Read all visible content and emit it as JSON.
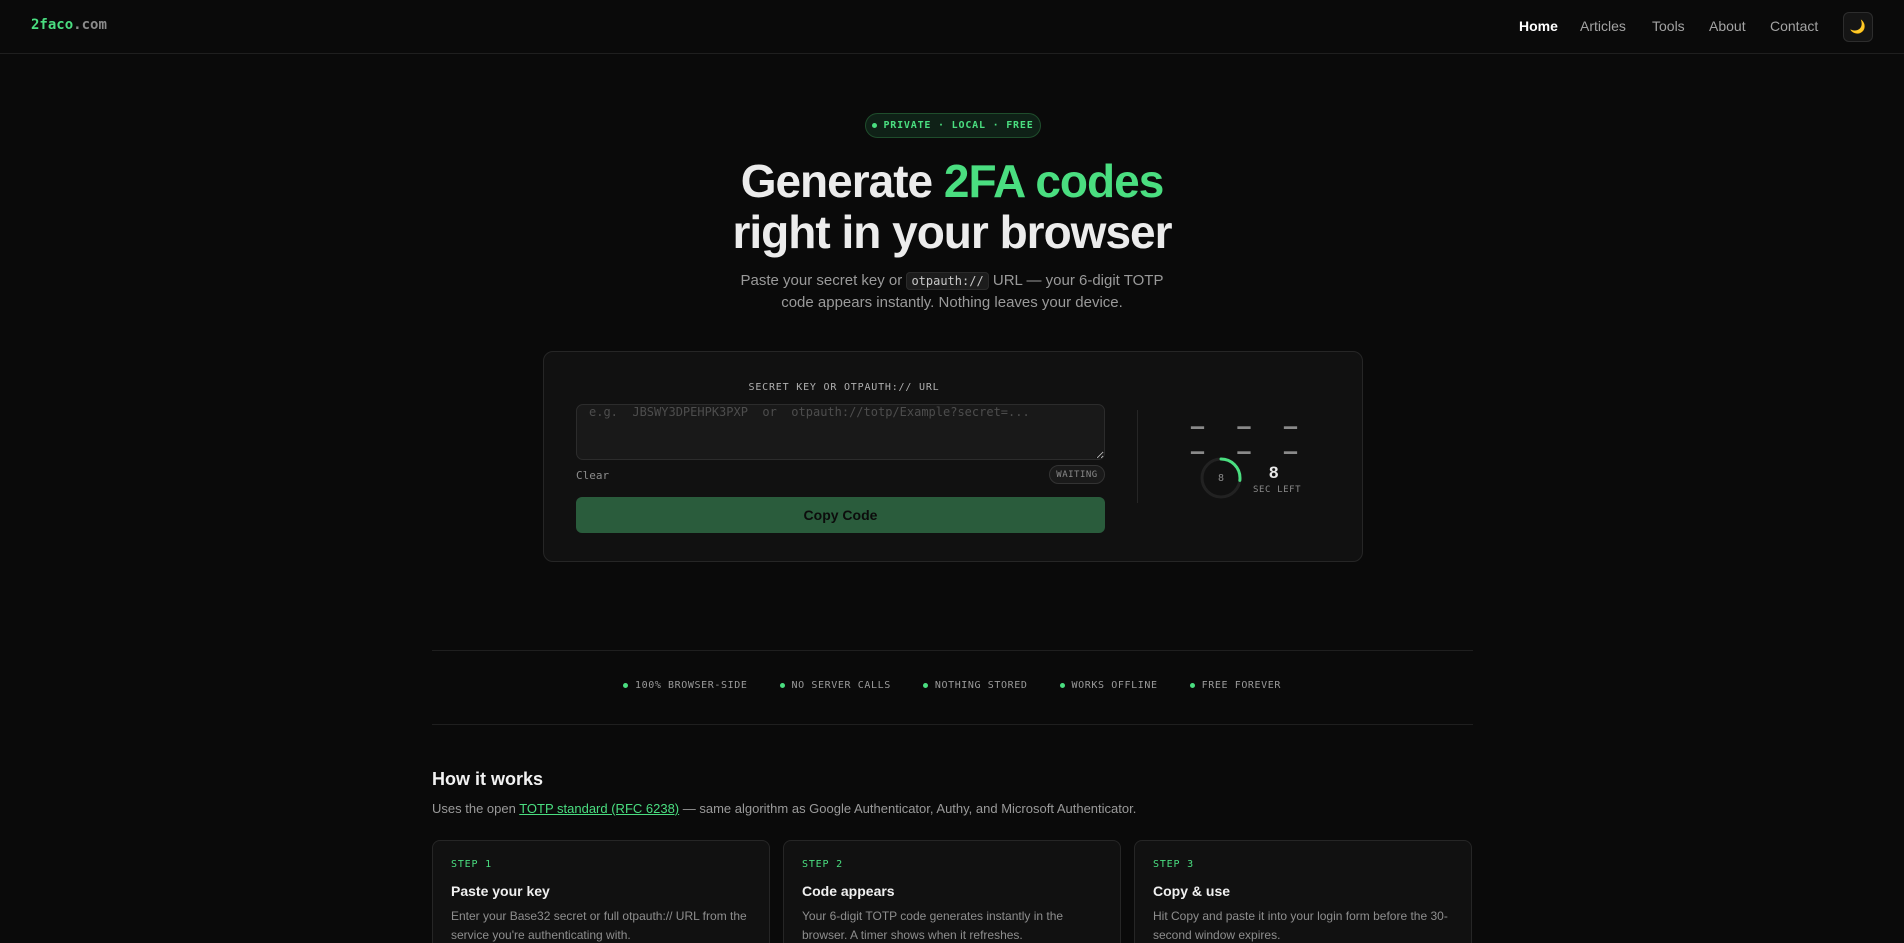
{
  "header": {
    "logo_primary": "2faco",
    "logo_suffix": ".com",
    "nav": [
      {
        "label": "Home",
        "active": true
      },
      {
        "label": "Articles"
      },
      {
        "label": "Tools"
      },
      {
        "label": "About"
      },
      {
        "label": "Contact"
      }
    ],
    "theme_toggle_icon": "moon-icon",
    "theme_toggle_glyph": "🌙"
  },
  "hero": {
    "pill_text": "PRIVATE · LOCAL · FREE",
    "title_line1_prefix": "Generate ",
    "title_line1_highlight": "2FA codes",
    "title_line2": "right in your browser",
    "subtitle_part1": "Paste your secret key or ",
    "subtitle_code": "otpauth://",
    "subtitle_part2": " URL — your 6-digit TOTP",
    "subtitle_line2": "code appears instantly. Nothing leaves your device."
  },
  "generator": {
    "field_label": "SECRET KEY OR OTPAUTH:// URL",
    "input_value": "",
    "input_placeholder": "e.g.  JBSWY3DPEHPK3PXP  or  otpauth://totp/Example?secret=...",
    "clear_label": "Clear",
    "status_badge": "WAITING",
    "copy_button": "Copy Code",
    "code_display": "– – – – – –",
    "ring_value": "8",
    "seconds_left": "8",
    "seconds_label": "SEC LEFT",
    "ring_progress": 0.27
  },
  "features": [
    "100% BROWSER-SIDE",
    "NO SERVER CALLS",
    "NOTHING STORED",
    "WORKS OFFLINE",
    "FREE FOREVER"
  ],
  "how": {
    "title": "How it works",
    "sub_prefix": "Uses the open ",
    "sub_link": "TOTP standard (RFC 6238)",
    "sub_suffix": " — same algorithm as Google Authenticator, Authy, and Microsoft Authenticator.",
    "steps": [
      {
        "num": "STEP 1",
        "title": "Paste your key",
        "desc": "Enter your Base32 secret or full otpauth:// URL from the service you're authenticating with."
      },
      {
        "num": "STEP 2",
        "title": "Code appears",
        "desc": "Your 6-digit TOTP code generates instantly in the browser. A timer shows when it refreshes."
      },
      {
        "num": "STEP 3",
        "title": "Copy & use",
        "desc": "Hit Copy and paste it into your login form before the 30-second window expires."
      }
    ]
  },
  "colors": {
    "accent": "#4ade80",
    "background": "#0a0a0a",
    "card": "#111111",
    "button": "#2a5c3c"
  }
}
